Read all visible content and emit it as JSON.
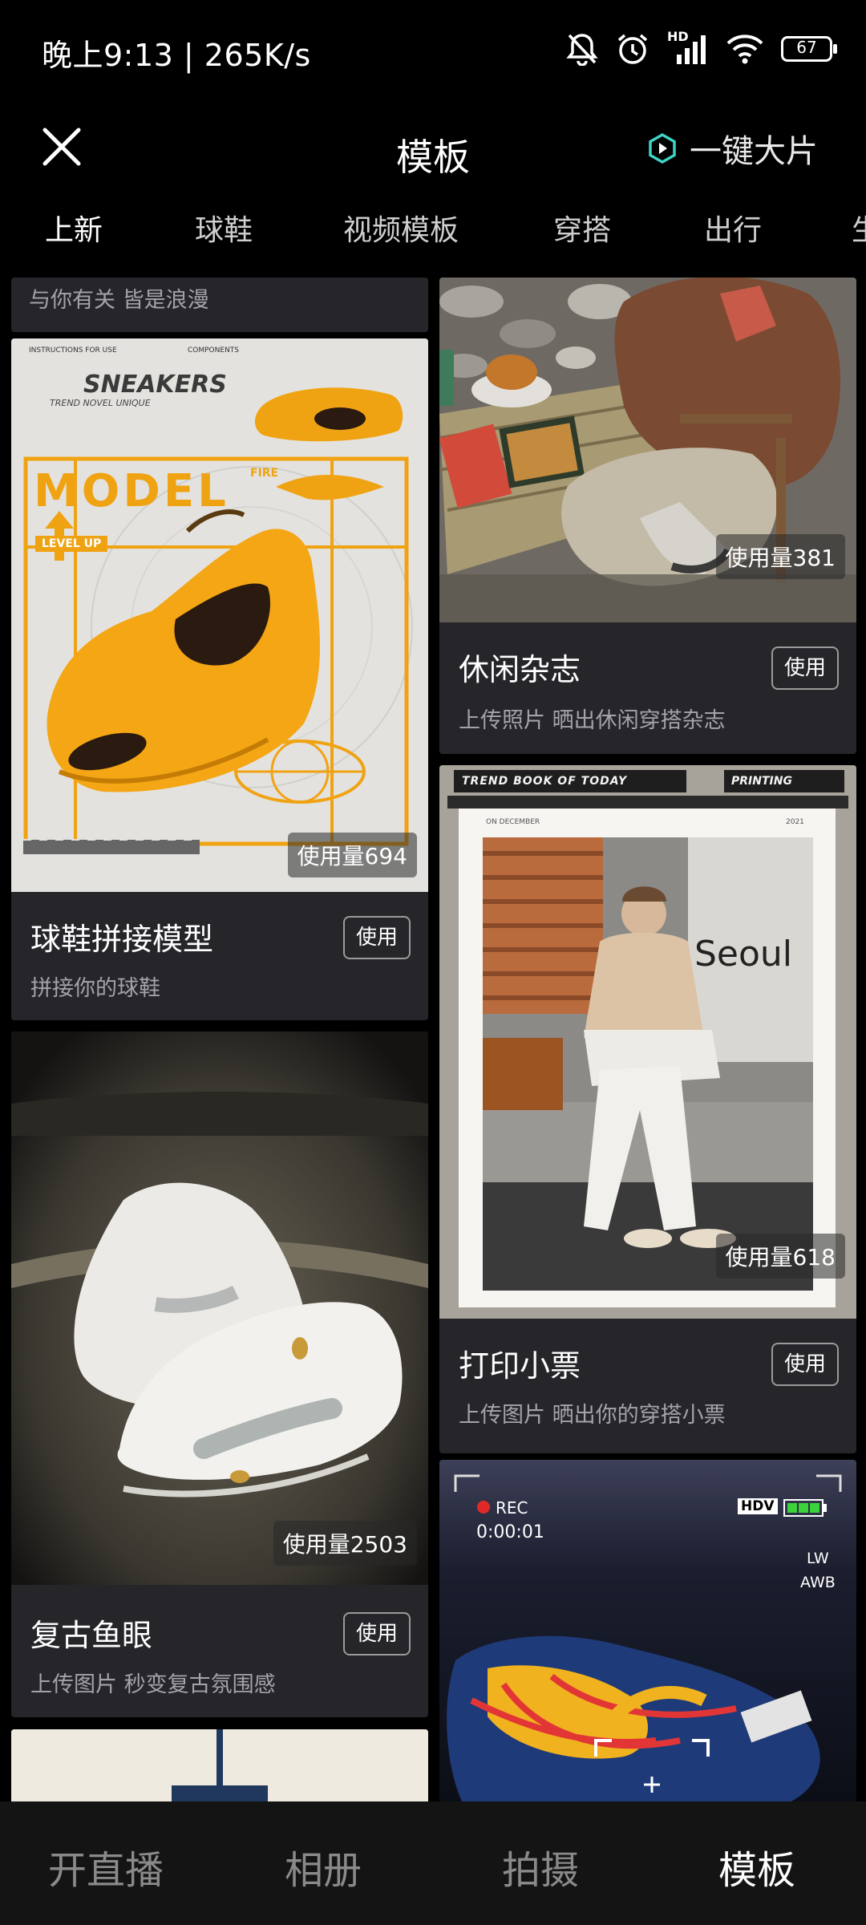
{
  "status": {
    "time_speed": "晚上9:13 | 265K/s",
    "battery": "67",
    "hd_label": "HD"
  },
  "header": {
    "title": "模板",
    "quick_label": "一键大片"
  },
  "tabs": [
    "上新",
    "球鞋",
    "视频模板",
    "穿搭",
    "出行",
    "生"
  ],
  "feed": {
    "top_partial_subtitle": "与你有关 皆是浪漫",
    "cards": [
      {
        "title": "球鞋拼接模型",
        "subtitle": "拼接你的球鞋",
        "usage": "使用量694",
        "button": "使用"
      },
      {
        "title": "复古鱼眼",
        "subtitle": "上传图片 秒变复古氛围感",
        "usage": "使用量2503",
        "button": "使用"
      },
      {
        "title": "休闲杂志",
        "subtitle": "上传照片 晒出休闲穿搭杂志",
        "usage": "使用量381",
        "button": "使用"
      },
      {
        "title": "打印小票",
        "subtitle": "上传图片 晒出你的穿搭小票",
        "usage": "使用量618",
        "button": "使用"
      }
    ],
    "poster_sneaker": {
      "top_left": "INSTRUCTIONS FOR USE",
      "top_mid": "COMPONENTS",
      "brand": "SNEAKERS",
      "tagline": "TREND  NOVEL  UNIQUE",
      "model": "MODEL",
      "fire": "FIRE",
      "level": "LEVEL UP"
    },
    "poster_receipt": {
      "left_label": "TREND BOOK OF TODAY",
      "right_label": "PRINTING",
      "date_left": "ON DECEMBER",
      "date_right": "2021",
      "sign_text": "Seoul"
    },
    "poster_rec": {
      "rec": "REC",
      "timecode": "0:00:01",
      "hdv": "HDV",
      "lw": "LW",
      "awb": "AWB"
    }
  },
  "bottom_nav": [
    "开直播",
    "相册",
    "拍摄",
    "模板"
  ],
  "colors": {
    "background": "#000000",
    "card_bg": "#26262a",
    "accent_teal": "#3fd3c6",
    "sneaker_orange": "#f0a312"
  }
}
